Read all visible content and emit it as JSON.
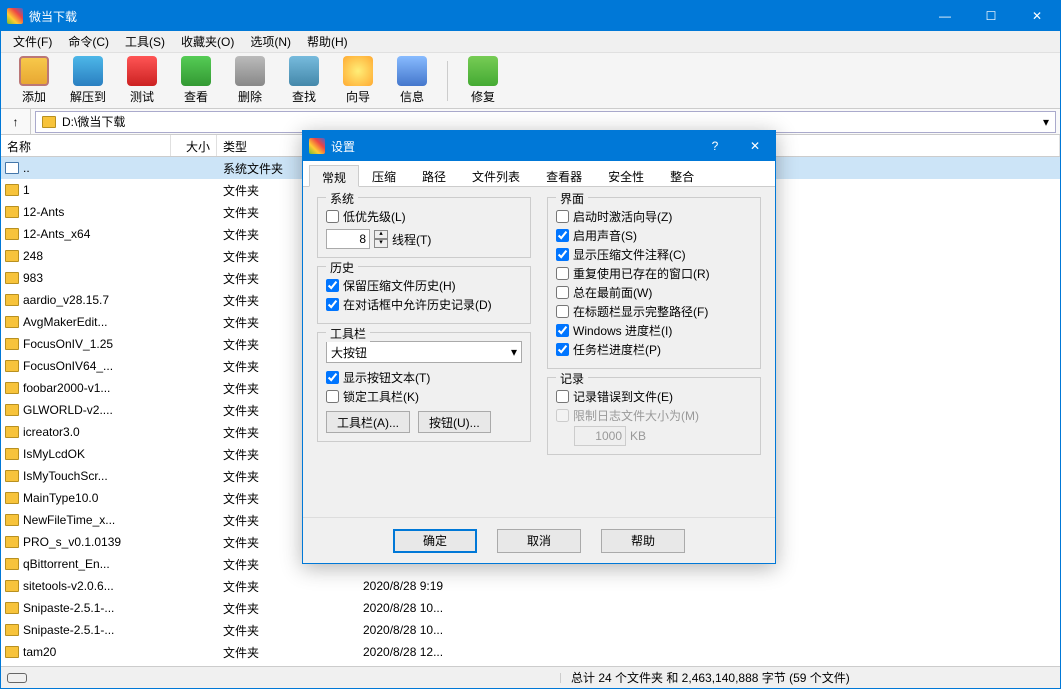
{
  "window": {
    "title": "微当下载",
    "min": "—",
    "max": "☐",
    "close": "✕"
  },
  "menu": [
    "文件(F)",
    "命令(C)",
    "工具(S)",
    "收藏夹(O)",
    "选项(N)",
    "帮助(H)"
  ],
  "toolbar": [
    {
      "id": "add",
      "label": "添加"
    },
    {
      "id": "extract",
      "label": "解压到"
    },
    {
      "id": "test",
      "label": "测试"
    },
    {
      "id": "view",
      "label": "查看"
    },
    {
      "id": "delete",
      "label": "删除"
    },
    {
      "id": "find",
      "label": "查找"
    },
    {
      "id": "wizard",
      "label": "向导"
    },
    {
      "id": "info",
      "label": "信息"
    },
    {
      "id": "sep",
      "label": ""
    },
    {
      "id": "repair",
      "label": "修复"
    }
  ],
  "path": {
    "up": "↑",
    "value": "D:\\微当下载",
    "drop": "▾"
  },
  "columns": {
    "name": "名称",
    "size": "大小",
    "type": "类型",
    "date": ""
  },
  "files": [
    {
      "name": "..",
      "type": "系统文件夹",
      "date": "",
      "ico": "up",
      "sel": true
    },
    {
      "name": "1",
      "type": "文件夹",
      "date": ""
    },
    {
      "name": "12-Ants",
      "type": "文件夹",
      "date": ""
    },
    {
      "name": "12-Ants_x64",
      "type": "文件夹",
      "date": ""
    },
    {
      "name": "248",
      "type": "文件夹",
      "date": ""
    },
    {
      "name": "983",
      "type": "文件夹",
      "date": ""
    },
    {
      "name": "aardio_v28.15.7",
      "type": "文件夹",
      "date": ""
    },
    {
      "name": "AvgMakerEdit...",
      "type": "文件夹",
      "date": ""
    },
    {
      "name": "FocusOnIV_1.25",
      "type": "文件夹",
      "date": ""
    },
    {
      "name": "FocusOnIV64_...",
      "type": "文件夹",
      "date": ""
    },
    {
      "name": "foobar2000-v1...",
      "type": "文件夹",
      "date": ""
    },
    {
      "name": "GLWORLD-v2....",
      "type": "文件夹",
      "date": ""
    },
    {
      "name": "icreator3.0",
      "type": "文件夹",
      "date": ""
    },
    {
      "name": "IsMyLcdOK",
      "type": "文件夹",
      "date": ""
    },
    {
      "name": "IsMyTouchScr...",
      "type": "文件夹",
      "date": ""
    },
    {
      "name": "MainType10.0",
      "type": "文件夹",
      "date": ""
    },
    {
      "name": "NewFileTime_x...",
      "type": "文件夹",
      "date": ""
    },
    {
      "name": "PRO_s_v0.1.0139",
      "type": "文件夹",
      "date": ""
    },
    {
      "name": "qBittorrent_En...",
      "type": "文件夹",
      "date": ""
    },
    {
      "name": "sitetools-v2.0.6...",
      "type": "文件夹",
      "date": "2020/8/28 9:19"
    },
    {
      "name": "Snipaste-2.5.1-...",
      "type": "文件夹",
      "date": "2020/8/28 10..."
    },
    {
      "name": "Snipaste-2.5.1-...",
      "type": "文件夹",
      "date": "2020/8/28 10..."
    },
    {
      "name": "tam20",
      "type": "文件夹",
      "date": "2020/8/28 12..."
    }
  ],
  "status": "总计 24 个文件夹 和 2,463,140,888 字节 (59 个文件)",
  "dialog": {
    "title": "设置",
    "help": "?",
    "close": "✕",
    "tabs": [
      "常规",
      "压缩",
      "路径",
      "文件列表",
      "查看器",
      "安全性",
      "整合"
    ],
    "groups": {
      "system": {
        "title": "系统",
        "low_priority": "低优先级(L)",
        "threads_val": "8",
        "spin_up": "▴",
        "spin_dn": "▾",
        "threads_label": "线程(T)"
      },
      "history": {
        "title": "历史",
        "keep": "保留压缩文件历史(H)",
        "allow": "在对话框中允许历史记录(D)"
      },
      "toolbar": {
        "title": "工具栏",
        "drop_val": "大按钮",
        "drop_arrow": "▾",
        "show_text": "显示按钮文本(T)",
        "lock": "锁定工具栏(K)",
        "btn_tb": "工具栏(A)...",
        "btn_bt": "按钮(U)..."
      },
      "interface": {
        "title": "界面",
        "wizard": "启动时激活向导(Z)",
        "sound": "启用声音(S)",
        "comment": "显示压缩文件注释(C)",
        "reuse": "重复使用已存在的窗口(R)",
        "ontop": "总在最前面(W)",
        "fullpath": "在标题栏显示完整路径(F)",
        "winprog": "Windows 进度栏(I)",
        "taskprog": "任务栏进度栏(P)"
      },
      "log": {
        "title": "记录",
        "logerr": "记录错误到文件(E)",
        "limit": "限制日志文件大小为(M)",
        "limit_val": "1000",
        "kb": "KB"
      }
    },
    "buttons": {
      "ok": "确定",
      "cancel": "取消",
      "help": "帮助"
    }
  }
}
